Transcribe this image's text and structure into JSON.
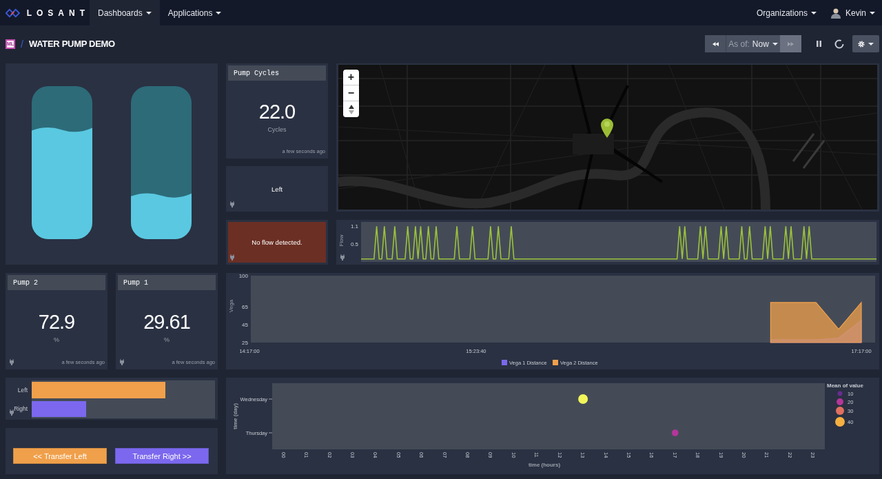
{
  "header": {
    "logo": "LOSANT",
    "nav": [
      {
        "label": "Dashboards",
        "selected": true
      },
      {
        "label": "Applications",
        "selected": false
      }
    ],
    "organizations": "Organizations",
    "user": "Kevin"
  },
  "title_bar": {
    "badge": "ML",
    "separator": "/",
    "title": "WATER PUMP DEMO",
    "time_control": {
      "prefix": "As of:",
      "value": "Now",
      "forward_disabled": true
    }
  },
  "tanks": [
    {
      "level": 0.71
    },
    {
      "level": 0.28
    }
  ],
  "pump_cycles": {
    "title": "Pump Cycles",
    "value": "22.0",
    "unit": "Cycles",
    "updated": "a few seconds ago"
  },
  "direction": {
    "text": "Left"
  },
  "flow_alert": {
    "text": "No flow detected."
  },
  "map": {
    "zoom_in": "+",
    "zoom_out": "−"
  },
  "flow_chart": {
    "chart_data": {
      "type": "line",
      "ylabel": "Flow",
      "yticks": [
        0.5,
        1.1
      ],
      "ylim": [
        -0.1,
        1.25
      ],
      "categories": [
        null,
        null,
        null,
        null,
        null,
        null,
        null,
        null,
        null,
        null,
        null,
        null,
        null,
        null,
        null,
        null,
        null,
        null,
        null,
        null,
        null,
        null,
        null,
        null,
        null,
        null,
        null,
        null,
        null,
        null,
        null,
        null,
        null,
        null,
        null,
        null,
        null,
        null,
        null,
        null,
        null,
        null,
        null,
        null,
        null,
        null,
        null,
        null,
        null,
        null,
        null,
        null,
        null,
        null,
        null,
        null,
        null,
        null,
        null,
        null,
        null,
        null,
        null,
        null,
        null,
        null,
        null,
        null,
        null,
        null,
        null,
        null,
        null,
        null,
        null,
        null,
        null,
        null,
        null,
        null,
        null,
        null,
        null,
        null,
        null,
        null,
        null,
        null,
        null,
        null,
        null,
        null,
        null,
        null,
        null,
        null,
        null,
        null,
        null,
        null,
        null,
        null,
        null,
        null,
        null,
        null,
        null,
        null,
        null,
        null,
        null,
        null,
        null,
        null,
        null,
        null,
        null,
        null,
        null,
        null,
        null,
        null,
        null,
        null,
        null,
        null,
        null,
        null,
        null,
        null,
        null,
        null,
        null,
        null,
        null,
        null,
        null,
        null,
        null,
        null,
        null,
        null,
        null,
        null,
        null,
        null,
        null,
        null,
        null,
        null,
        null,
        null,
        null,
        null,
        null,
        null,
        null,
        null,
        null,
        null,
        null,
        null,
        null,
        null,
        null,
        null,
        null,
        null,
        null,
        null,
        null,
        null,
        null,
        null,
        null,
        null,
        null,
        null,
        null,
        null,
        null,
        null,
        null,
        null,
        null,
        null,
        null,
        null,
        null,
        null,
        null,
        null,
        null,
        null,
        null,
        null,
        null,
        null,
        null,
        null
      ],
      "series": [
        {
          "color": "#9bc23c",
          "values": [
            0,
            0,
            0,
            0,
            0,
            0,
            1.1,
            0,
            0,
            1.1,
            0,
            0,
            0,
            1.1,
            0,
            0,
            0,
            0,
            1.1,
            0,
            0,
            1.1,
            0,
            1.1,
            0,
            0,
            1.1,
            0,
            0,
            1.1,
            0,
            0,
            0,
            0,
            0,
            0,
            0,
            1.1,
            0,
            0,
            0,
            0,
            0,
            1.1,
            0,
            0,
            0,
            0,
            0,
            0,
            1.1,
            0,
            0,
            1.1,
            0,
            0,
            0,
            0,
            1.1,
            0,
            0,
            0,
            0,
            0,
            0,
            0,
            0,
            0,
            0,
            0,
            0,
            0,
            0,
            0,
            0,
            0,
            0,
            0,
            0,
            0,
            0,
            0,
            0,
            0,
            0,
            0,
            0,
            0,
            0,
            0,
            0,
            0,
            0,
            0,
            0,
            0,
            0,
            0,
            0,
            0,
            0,
            0,
            0,
            0,
            0,
            0,
            0,
            0,
            0,
            0,
            0,
            0,
            0,
            0,
            0,
            0,
            0,
            0,
            0,
            0,
            0,
            0,
            0,
            1.1,
            0,
            1.1,
            0,
            0,
            0,
            0,
            0,
            1.1,
            0,
            1.1,
            0,
            0,
            0,
            0,
            0,
            1.1,
            0,
            1.1,
            0,
            0,
            0,
            0,
            0,
            1.1,
            0,
            0,
            1.1,
            0,
            0,
            0,
            0,
            0,
            1.1,
            0,
            1.1,
            0,
            0,
            0,
            0,
            0,
            1.1,
            0,
            1.1,
            0,
            0,
            0,
            0,
            1.1,
            0,
            1.1,
            0,
            0,
            0,
            0,
            0,
            0,
            0,
            0,
            0,
            0,
            0,
            0,
            0,
            0,
            0,
            0,
            0,
            0,
            0,
            0,
            0,
            0,
            0,
            0,
            0,
            0
          ]
        }
      ]
    }
  },
  "gauges": [
    {
      "title": "Pump 2",
      "value": "72.9",
      "unit": "%",
      "updated": "a few seconds ago"
    },
    {
      "title": "Pump 1",
      "value": "29.61",
      "unit": "%",
      "updated": "a few seconds ago"
    }
  ],
  "distance_chart": {
    "chart_data": {
      "type": "area",
      "ylabel": "Vega",
      "yticks": [
        25,
        45,
        65,
        100
      ],
      "ylim": [
        25,
        100
      ],
      "legend": "bottom",
      "categories": [
        "14:17:00",
        null,
        null,
        null,
        null,
        null,
        null,
        null,
        null,
        null,
        "15:23:40",
        null,
        null,
        null,
        null,
        null,
        null,
        null,
        null,
        null,
        null,
        null,
        null,
        null,
        null,
        null,
        null,
        "17:17:00"
      ],
      "series": [
        {
          "name": "Vega 1 Distance",
          "color": "#7b68ee",
          "values": [
            null,
            null,
            null,
            null,
            null,
            null,
            null,
            null,
            null,
            null,
            null,
            null,
            null,
            null,
            null,
            null,
            null,
            null,
            null,
            null,
            null,
            null,
            null,
            28,
            28,
            28,
            30,
            50
          ]
        },
        {
          "name": "Vega 2 Distance",
          "color": "#f0a04b",
          "values": [
            null,
            null,
            null,
            null,
            null,
            null,
            null,
            null,
            null,
            null,
            null,
            null,
            null,
            null,
            null,
            null,
            null,
            null,
            null,
            null,
            null,
            null,
            null,
            70,
            70,
            70,
            40,
            70
          ]
        }
      ]
    }
  },
  "bars": [
    {
      "label": "Left",
      "level": 0.729,
      "color": "#f0a04b"
    },
    {
      "label": "Right",
      "level": 0.296,
      "color": "#7b68ee"
    }
  ],
  "buttons": [
    {
      "label": "<< Transfer Left",
      "color": "#f0a04b"
    },
    {
      "label": "Transfer Right >>",
      "color": "#7b68ee"
    }
  ],
  "time_chart": {
    "chart_data": {
      "type": "scatter",
      "orientation": "horizontal",
      "xlabel": "time (hours)",
      "ylabel": "time (day)",
      "categories": [
        "Wednesday",
        "Thursday"
      ],
      "xlim": [
        -0.5,
        23.5
      ],
      "xticks": [
        {
          "value": 0,
          "label": "00"
        },
        {
          "value": 1,
          "label": "01"
        },
        {
          "value": 2,
          "label": "02"
        },
        {
          "value": 3,
          "label": "03"
        },
        {
          "value": 4,
          "label": "04"
        },
        {
          "value": 5,
          "label": "05"
        },
        {
          "value": 6,
          "label": "06"
        },
        {
          "value": 7,
          "label": "07"
        },
        {
          "value": 8,
          "label": "08"
        },
        {
          "value": 9,
          "label": "09"
        },
        {
          "value": 10,
          "label": "10"
        },
        {
          "value": 11,
          "label": "11"
        },
        {
          "value": 12,
          "label": "12"
        },
        {
          "value": 13,
          "label": "13"
        },
        {
          "value": 14,
          "label": "14"
        },
        {
          "value": 15,
          "label": "15"
        },
        {
          "value": 16,
          "label": "16"
        },
        {
          "value": 17,
          "label": "17"
        },
        {
          "value": 18,
          "label": "18"
        },
        {
          "value": 19,
          "label": "19"
        },
        {
          "value": 20,
          "label": "20"
        },
        {
          "value": 21,
          "label": "21"
        },
        {
          "value": 22,
          "label": "22"
        },
        {
          "value": 23,
          "label": "23"
        }
      ],
      "series": [
        {
          "name": "Mean of value",
          "values": [
            13,
            17
          ]
        }
      ]
    },
    "marks": [
      {
        "color": "#f2f55a",
        "kind": "large"
      },
      {
        "color": "#b5369a",
        "kind": "small"
      }
    ],
    "legend": {
      "items": [
        {
          "label": "10",
          "color": "#6a2c91"
        },
        {
          "label": "20",
          "color": "#b5369a"
        },
        {
          "label": "30",
          "color": "#e07060"
        },
        {
          "label": "40",
          "color": "#f5b041"
        }
      ]
    }
  }
}
